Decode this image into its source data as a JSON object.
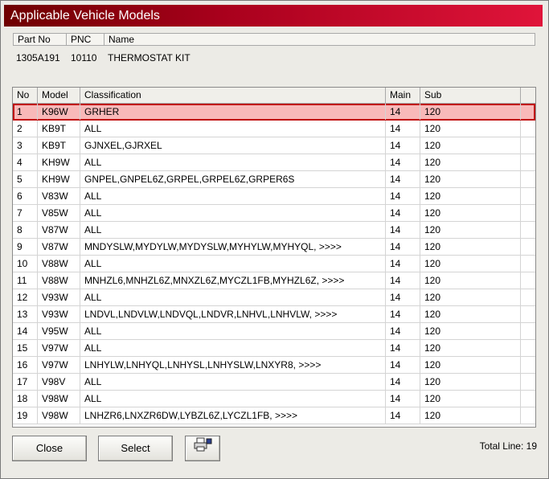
{
  "window": {
    "title": "Applicable Vehicle Models"
  },
  "part": {
    "headers": {
      "part_no": "Part No",
      "pnc": "PNC",
      "name": "Name"
    },
    "values": {
      "part_no": "1305A191",
      "pnc": "10110",
      "name": "THERMOSTAT KIT"
    }
  },
  "grid": {
    "headers": {
      "no": "No",
      "model": "Model",
      "classification": "Classification",
      "main": "Main",
      "sub": "Sub"
    },
    "selected_row": 0,
    "selection_color": "#f8b9b9",
    "rows": [
      {
        "no": "1",
        "model": "K96W",
        "classification": "GRHER",
        "main": "14",
        "sub": "120"
      },
      {
        "no": "2",
        "model": "KB9T",
        "classification": "ALL",
        "main": "14",
        "sub": "120"
      },
      {
        "no": "3",
        "model": "KB9T",
        "classification": "GJNXEL,GJRXEL",
        "main": "14",
        "sub": "120"
      },
      {
        "no": "4",
        "model": "KH9W",
        "classification": "ALL",
        "main": "14",
        "sub": "120"
      },
      {
        "no": "5",
        "model": "KH9W",
        "classification": "GNPEL,GNPEL6Z,GRPEL,GRPEL6Z,GRPER6S",
        "main": "14",
        "sub": "120"
      },
      {
        "no": "6",
        "model": "V83W",
        "classification": "ALL",
        "main": "14",
        "sub": "120"
      },
      {
        "no": "7",
        "model": "V85W",
        "classification": "ALL",
        "main": "14",
        "sub": "120"
      },
      {
        "no": "8",
        "model": "V87W",
        "classification": "ALL",
        "main": "14",
        "sub": "120"
      },
      {
        "no": "9",
        "model": "V87W",
        "classification": "MNDYSLW,MYDYLW,MYDYSLW,MYHYLW,MYHYQL,  >>>>",
        "main": "14",
        "sub": "120"
      },
      {
        "no": "10",
        "model": "V88W",
        "classification": "ALL",
        "main": "14",
        "sub": "120"
      },
      {
        "no": "11",
        "model": "V88W",
        "classification": "MNHZL6,MNHZL6Z,MNXZL6Z,MYCZL1FB,MYHZL6Z,  >>>>",
        "main": "14",
        "sub": "120"
      },
      {
        "no": "12",
        "model": "V93W",
        "classification": "ALL",
        "main": "14",
        "sub": "120"
      },
      {
        "no": "13",
        "model": "V93W",
        "classification": "LNDVL,LNDVLW,LNDVQL,LNDVR,LNHVL,LNHVLW,  >>>>",
        "main": "14",
        "sub": "120"
      },
      {
        "no": "14",
        "model": "V95W",
        "classification": "ALL",
        "main": "14",
        "sub": "120"
      },
      {
        "no": "15",
        "model": "V97W",
        "classification": "ALL",
        "main": "14",
        "sub": "120"
      },
      {
        "no": "16",
        "model": "V97W",
        "classification": "LNHYLW,LNHYQL,LNHYSL,LNHYSLW,LNXYR8,  >>>>",
        "main": "14",
        "sub": "120"
      },
      {
        "no": "17",
        "model": "V98V",
        "classification": "ALL",
        "main": "14",
        "sub": "120"
      },
      {
        "no": "18",
        "model": "V98W",
        "classification": "ALL",
        "main": "14",
        "sub": "120"
      },
      {
        "no": "19",
        "model": "V98W",
        "classification": "LNHZR6,LNXZR6DW,LYBZL6Z,LYCZL1FB,  >>>>",
        "main": "14",
        "sub": "120"
      }
    ]
  },
  "footer": {
    "close_label": "Close",
    "select_label": "Select",
    "print_icon": "printer-icon",
    "total_label": "Total Line: 19"
  }
}
